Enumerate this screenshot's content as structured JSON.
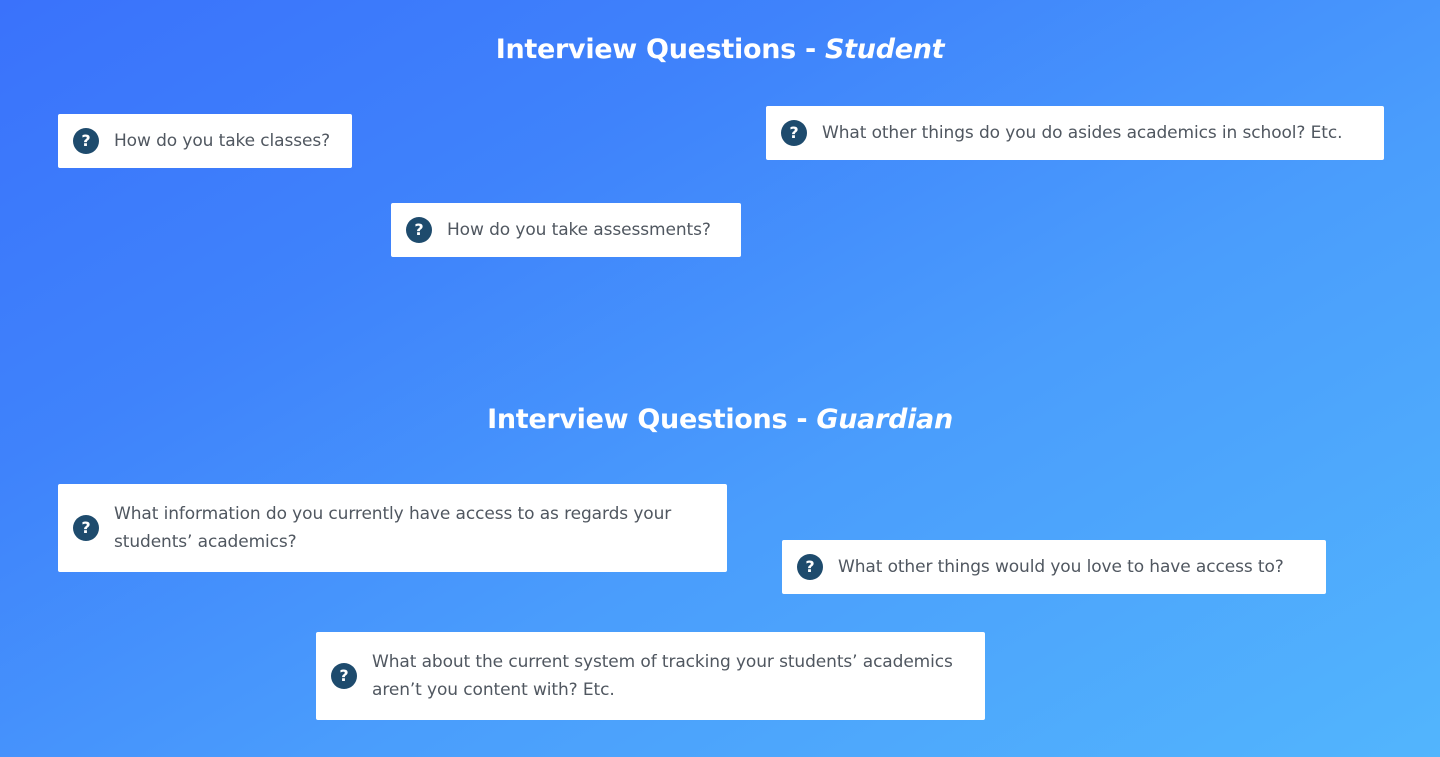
{
  "sections": {
    "student": {
      "title_prefix": "Interview Questions - ",
      "title_emphasis": "Student",
      "questions": [
        "How do you take classes?",
        "How do you take assessments?",
        "What other things do you do asides academics in school? Etc."
      ]
    },
    "guardian": {
      "title_prefix": "Interview Questions - ",
      "title_emphasis": "Guardian",
      "questions": [
        "What information do you currently have access to as regards your students’ academics?",
        "What other things would you love to have access to?",
        "What about the current system of tracking your students’ academics aren’t you content with? Etc."
      ]
    }
  },
  "icon": {
    "name": "question-circle-icon",
    "glyph": "?",
    "color": "#1e4b6d"
  },
  "colors": {
    "background_start": "#3a72fb",
    "background_end": "#52b5fd",
    "card": "#ffffff",
    "text": "#505760"
  }
}
